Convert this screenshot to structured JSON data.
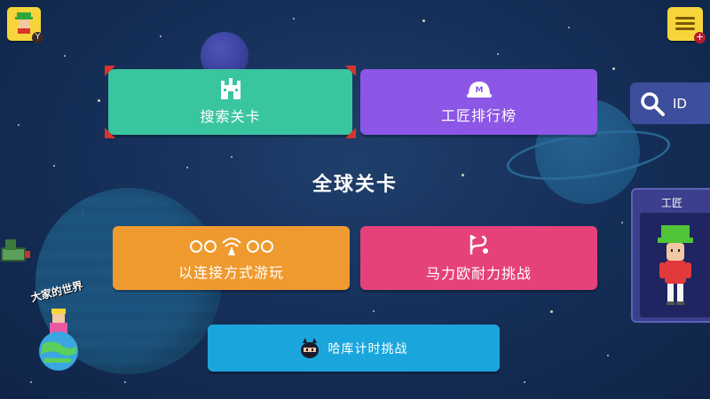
{
  "header": {
    "avatar": {
      "icon": "mii-avatar-icon",
      "badge": "Y"
    },
    "menu": {
      "icon": "menu-icon",
      "badge": "+"
    }
  },
  "main": {
    "section_title": "全球关卡",
    "cards": {
      "search": {
        "label": "搜索关卡",
        "icon": "castle-icon"
      },
      "ranking": {
        "label": "工匠排行榜",
        "icon": "maker-helmet-icon"
      },
      "online": {
        "label": "以连接方式游玩",
        "icon": "wireless-players-icon"
      },
      "endless": {
        "label": "马力欧耐力挑战",
        "icon": "route-flag-icon"
      },
      "ninji": {
        "label": "哈库计时挑战",
        "icon": "ninji-icon"
      }
    }
  },
  "side": {
    "id_search": {
      "label": "ID",
      "icon": "search-icon"
    },
    "maker_panel": {
      "title": "工匠",
      "icon": "mii-character-icon"
    }
  },
  "world": {
    "label": "大家的世界",
    "icon": "globe-world-icon"
  },
  "colors": {
    "background": "#16305a",
    "search": "#3ac5a1",
    "ranking": "#8c56e6",
    "online": "#ef9a2f",
    "endless": "#e5417b",
    "ninji": "#1aa6dd",
    "selection_corner": "#d9342b",
    "yellow_button": "#f7d53a",
    "side_panel": "#3b3f8d"
  }
}
